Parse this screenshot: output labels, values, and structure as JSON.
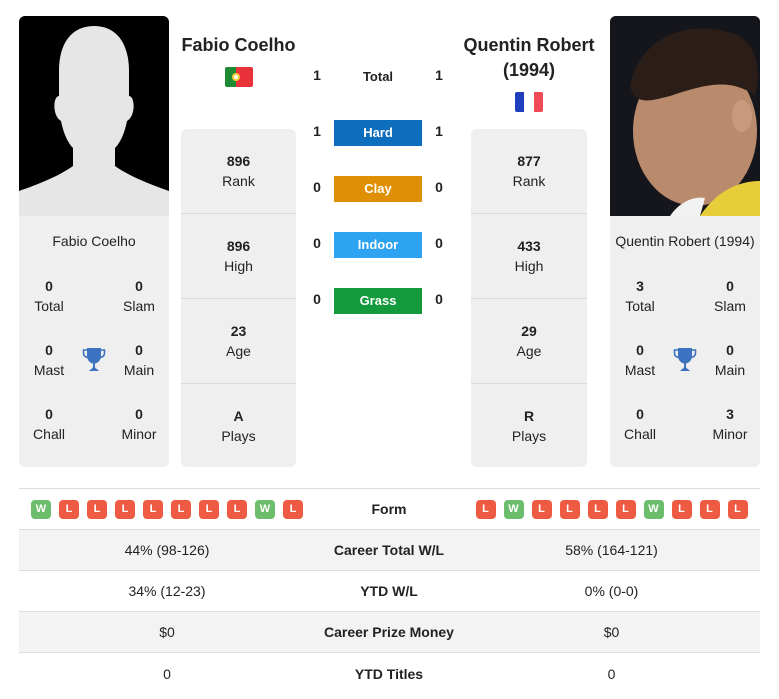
{
  "colors": {
    "hard": "#0d6ebd",
    "clay": "#de8f04",
    "indoor": "#2ea3f2",
    "grass": "#139a3c",
    "win": "#6cbd6c",
    "loss": "#ef5b42",
    "trophy": "#3c72c0"
  },
  "player1": {
    "name": "Fabio Coelho",
    "country_flag": "portugal-flag",
    "titles": {
      "name": "Fabio Coelho",
      "total": {
        "value": "0",
        "label": "Total"
      },
      "slam": {
        "value": "0",
        "label": "Slam"
      },
      "mast": {
        "value": "0",
        "label": "Mast"
      },
      "main": {
        "value": "0",
        "label": "Main"
      },
      "chall": {
        "value": "0",
        "label": "Chall"
      },
      "minor": {
        "value": "0",
        "label": "Minor"
      }
    },
    "info": {
      "rank": {
        "value": "896",
        "label": "Rank"
      },
      "high": {
        "value": "896",
        "label": "High"
      },
      "age": {
        "value": "23",
        "label": "Age"
      },
      "plays": {
        "value": "A",
        "label": "Plays"
      }
    },
    "form": [
      "W",
      "L",
      "L",
      "L",
      "L",
      "L",
      "L",
      "L",
      "W",
      "L"
    ]
  },
  "player2": {
    "name": "Quentin Robert (1994)",
    "country_flag": "france-flag",
    "titles": {
      "name": "Quentin Robert (1994)",
      "total": {
        "value": "3",
        "label": "Total"
      },
      "slam": {
        "value": "0",
        "label": "Slam"
      },
      "mast": {
        "value": "0",
        "label": "Mast"
      },
      "main": {
        "value": "0",
        "label": "Main"
      },
      "chall": {
        "value": "0",
        "label": "Chall"
      },
      "minor": {
        "value": "3",
        "label": "Minor"
      }
    },
    "info": {
      "rank": {
        "value": "877",
        "label": "Rank"
      },
      "high": {
        "value": "433",
        "label": "High"
      },
      "age": {
        "value": "29",
        "label": "Age"
      },
      "plays": {
        "value": "R",
        "label": "Plays"
      }
    },
    "form": [
      "L",
      "W",
      "L",
      "L",
      "L",
      "L",
      "W",
      "L",
      "L",
      "L"
    ]
  },
  "h2h": {
    "total": {
      "label": "Total",
      "p1": "1",
      "p2": "1"
    },
    "hard": {
      "label": "Hard",
      "p1": "1",
      "p2": "1"
    },
    "clay": {
      "label": "Clay",
      "p1": "0",
      "p2": "0"
    },
    "indoor": {
      "label": "Indoor",
      "p1": "0",
      "p2": "0"
    },
    "grass": {
      "label": "Grass",
      "p1": "0",
      "p2": "0"
    }
  },
  "comparison": {
    "form_label": "Form",
    "rows": [
      {
        "label": "Career Total W/L",
        "p1": "44% (98-126)",
        "p2": "58% (164-121)"
      },
      {
        "label": "YTD W/L",
        "p1": "34% (12-23)",
        "p2": "0% (0-0)"
      },
      {
        "label": "Career Prize Money",
        "p1": "$0",
        "p2": "$0"
      },
      {
        "label": "YTD Titles",
        "p1": "0",
        "p2": "0"
      }
    ]
  }
}
